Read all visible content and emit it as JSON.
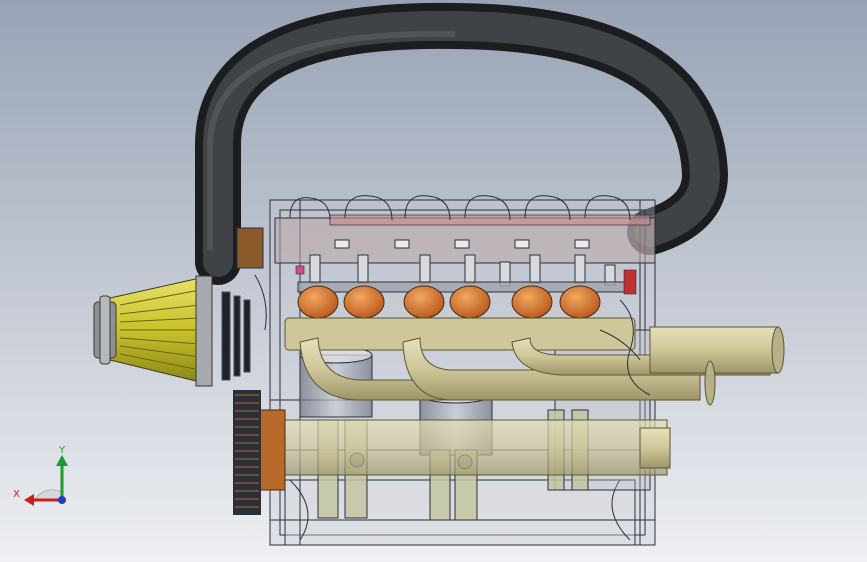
{
  "viewport": {
    "background_top": "#98a3b6",
    "background_bottom": "#eef0f3"
  },
  "model": {
    "hose_color": "#2b2d30",
    "filter_color": "#c9c22a",
    "cylinder_color": "#d2722f",
    "manifold_color": "#cfc79a",
    "belt_color": "#8a5a2a",
    "wire_color": "#2a2f3a"
  },
  "triad": {
    "x_label": "X",
    "y_label": "Y",
    "x_color": "#c41e1e",
    "y_color": "#1e9a2e",
    "z_color": "#1f3fbf"
  }
}
